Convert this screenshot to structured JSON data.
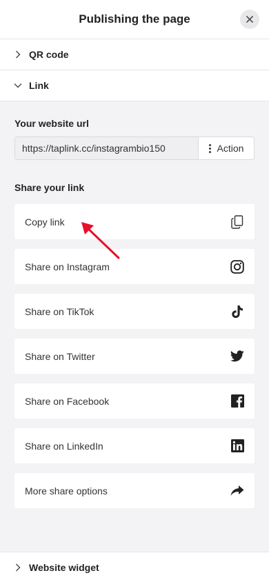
{
  "header": {
    "title": "Publishing the page"
  },
  "sections": {
    "qr_code": "QR code",
    "link": "Link",
    "website_widget": "Website widget"
  },
  "link_panel": {
    "url_title": "Your website url",
    "url_value": "https://taplink.cc/instagrambio150",
    "action_label": "Action",
    "share_title": "Share your link"
  },
  "share_items": [
    {
      "label": "Copy link",
      "icon": "copy-icon"
    },
    {
      "label": "Share on Instagram",
      "icon": "instagram-icon"
    },
    {
      "label": "Share on TikTok",
      "icon": "tiktok-icon"
    },
    {
      "label": "Share on Twitter",
      "icon": "twitter-icon"
    },
    {
      "label": "Share on Facebook",
      "icon": "facebook-icon"
    },
    {
      "label": "Share on LinkedIn",
      "icon": "linkedin-icon"
    },
    {
      "label": "More share options",
      "icon": "share-arrow-icon"
    }
  ],
  "colors": {
    "panel_bg": "#f3f3f5",
    "annotation": "#e8102a"
  }
}
